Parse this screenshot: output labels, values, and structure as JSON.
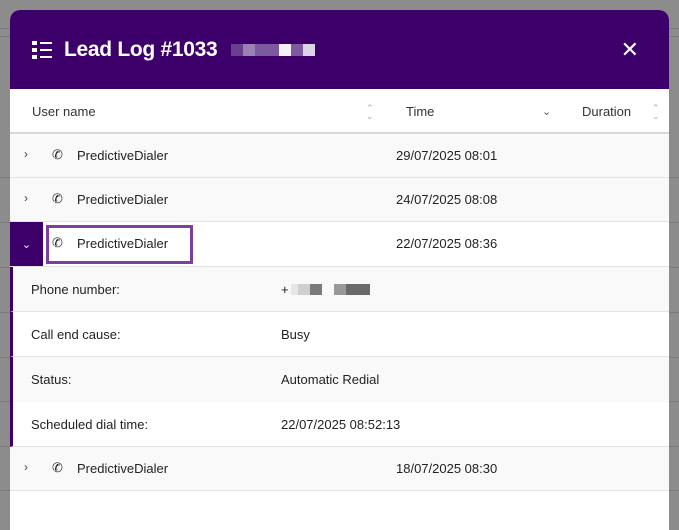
{
  "header": {
    "title": "Lead Log #1033",
    "close_icon": "close-icon",
    "menu_icon": "list-icon"
  },
  "columns": {
    "user_name": "User name",
    "time": "Time",
    "duration": "Duration"
  },
  "rows": [
    {
      "user": "PredictiveDialer",
      "time": "29/07/2025 08:01"
    },
    {
      "user": "PredictiveDialer",
      "time": "24/07/2025 08:08"
    },
    {
      "user": "PredictiveDialer",
      "time": "22/07/2025 08:36"
    },
    {
      "user": "PredictiveDialer",
      "time": "18/07/2025 08:30"
    }
  ],
  "details": [
    {
      "label": "Phone number:",
      "value": "+"
    },
    {
      "label": "Call end cause:",
      "value": "Busy"
    },
    {
      "label": "Status:",
      "value": "Automatic Redial"
    },
    {
      "label": "Scheduled dial time:",
      "value": "22/07/2025 08:52:13"
    }
  ],
  "colors": {
    "accent": "#3d006b",
    "focus": "#7b3fa0"
  }
}
